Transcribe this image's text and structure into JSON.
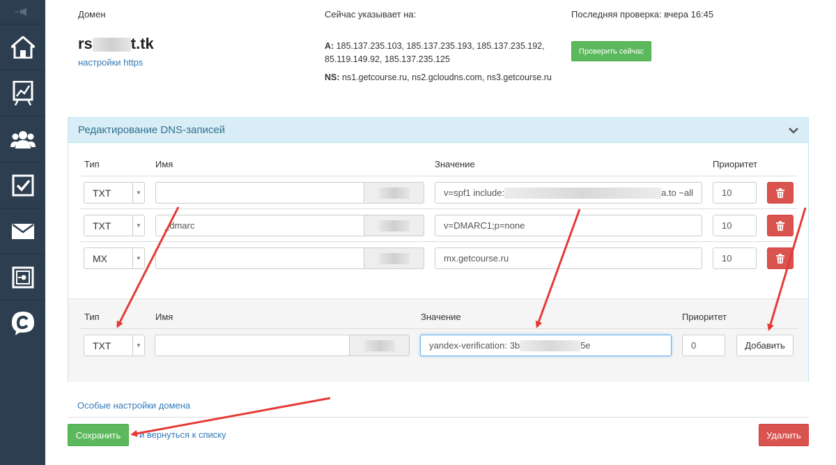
{
  "domain": {
    "label": "Домен",
    "name_prefix": "rs",
    "name_suffix": "t.tk",
    "https_link": "настройки https"
  },
  "pointing": {
    "label": "Сейчас указывает на:",
    "a_label": "A:",
    "a_line1": "185.137.235.103, 185.137.235.193, 185.137.235.192,",
    "a_line2": "85.119.149.92, 185.137.235.125",
    "ns_label": "NS:",
    "ns_value": "ns1.getcourse.ru, ns2.gcloudns.com, ns3.getcourse.ru"
  },
  "check": {
    "label": "Последняя проверка: вчера 16:45",
    "button": "Проверить сейчас"
  },
  "dns_panel": {
    "title": "Редактирование DNS-записей",
    "headers": {
      "type": "Тип",
      "name": "Имя",
      "value": "Значение",
      "priority": "Приоритет"
    },
    "records": [
      {
        "type": "TXT",
        "name": "",
        "value_prefix": "v=spf1 include:",
        "value_suffix": "a.to ~all",
        "priority": "10"
      },
      {
        "type": "TXT",
        "name": "_dmarc",
        "value_prefix": "v=DMARC1;p=none",
        "value_suffix": "",
        "priority": "10"
      },
      {
        "type": "MX",
        "name": "",
        "value_prefix": "mx.getcourse.ru",
        "value_suffix": "",
        "priority": "10"
      }
    ],
    "new_record": {
      "type": "TXT",
      "name": "",
      "value_prefix": "yandex-verification: 3b",
      "value_suffix": "5e",
      "priority": "0",
      "add_button": "Добавить"
    }
  },
  "footer": {
    "special_settings": "Особые настройки домена",
    "save": "Сохранить",
    "back": "и вернуться к списку",
    "delete": "Удалить"
  },
  "colors": {
    "sidebar": "#2d3e50",
    "success": "#5cb85c",
    "danger": "#d9534f",
    "link": "#337ab7",
    "annotation_arrow": "#e53935"
  }
}
